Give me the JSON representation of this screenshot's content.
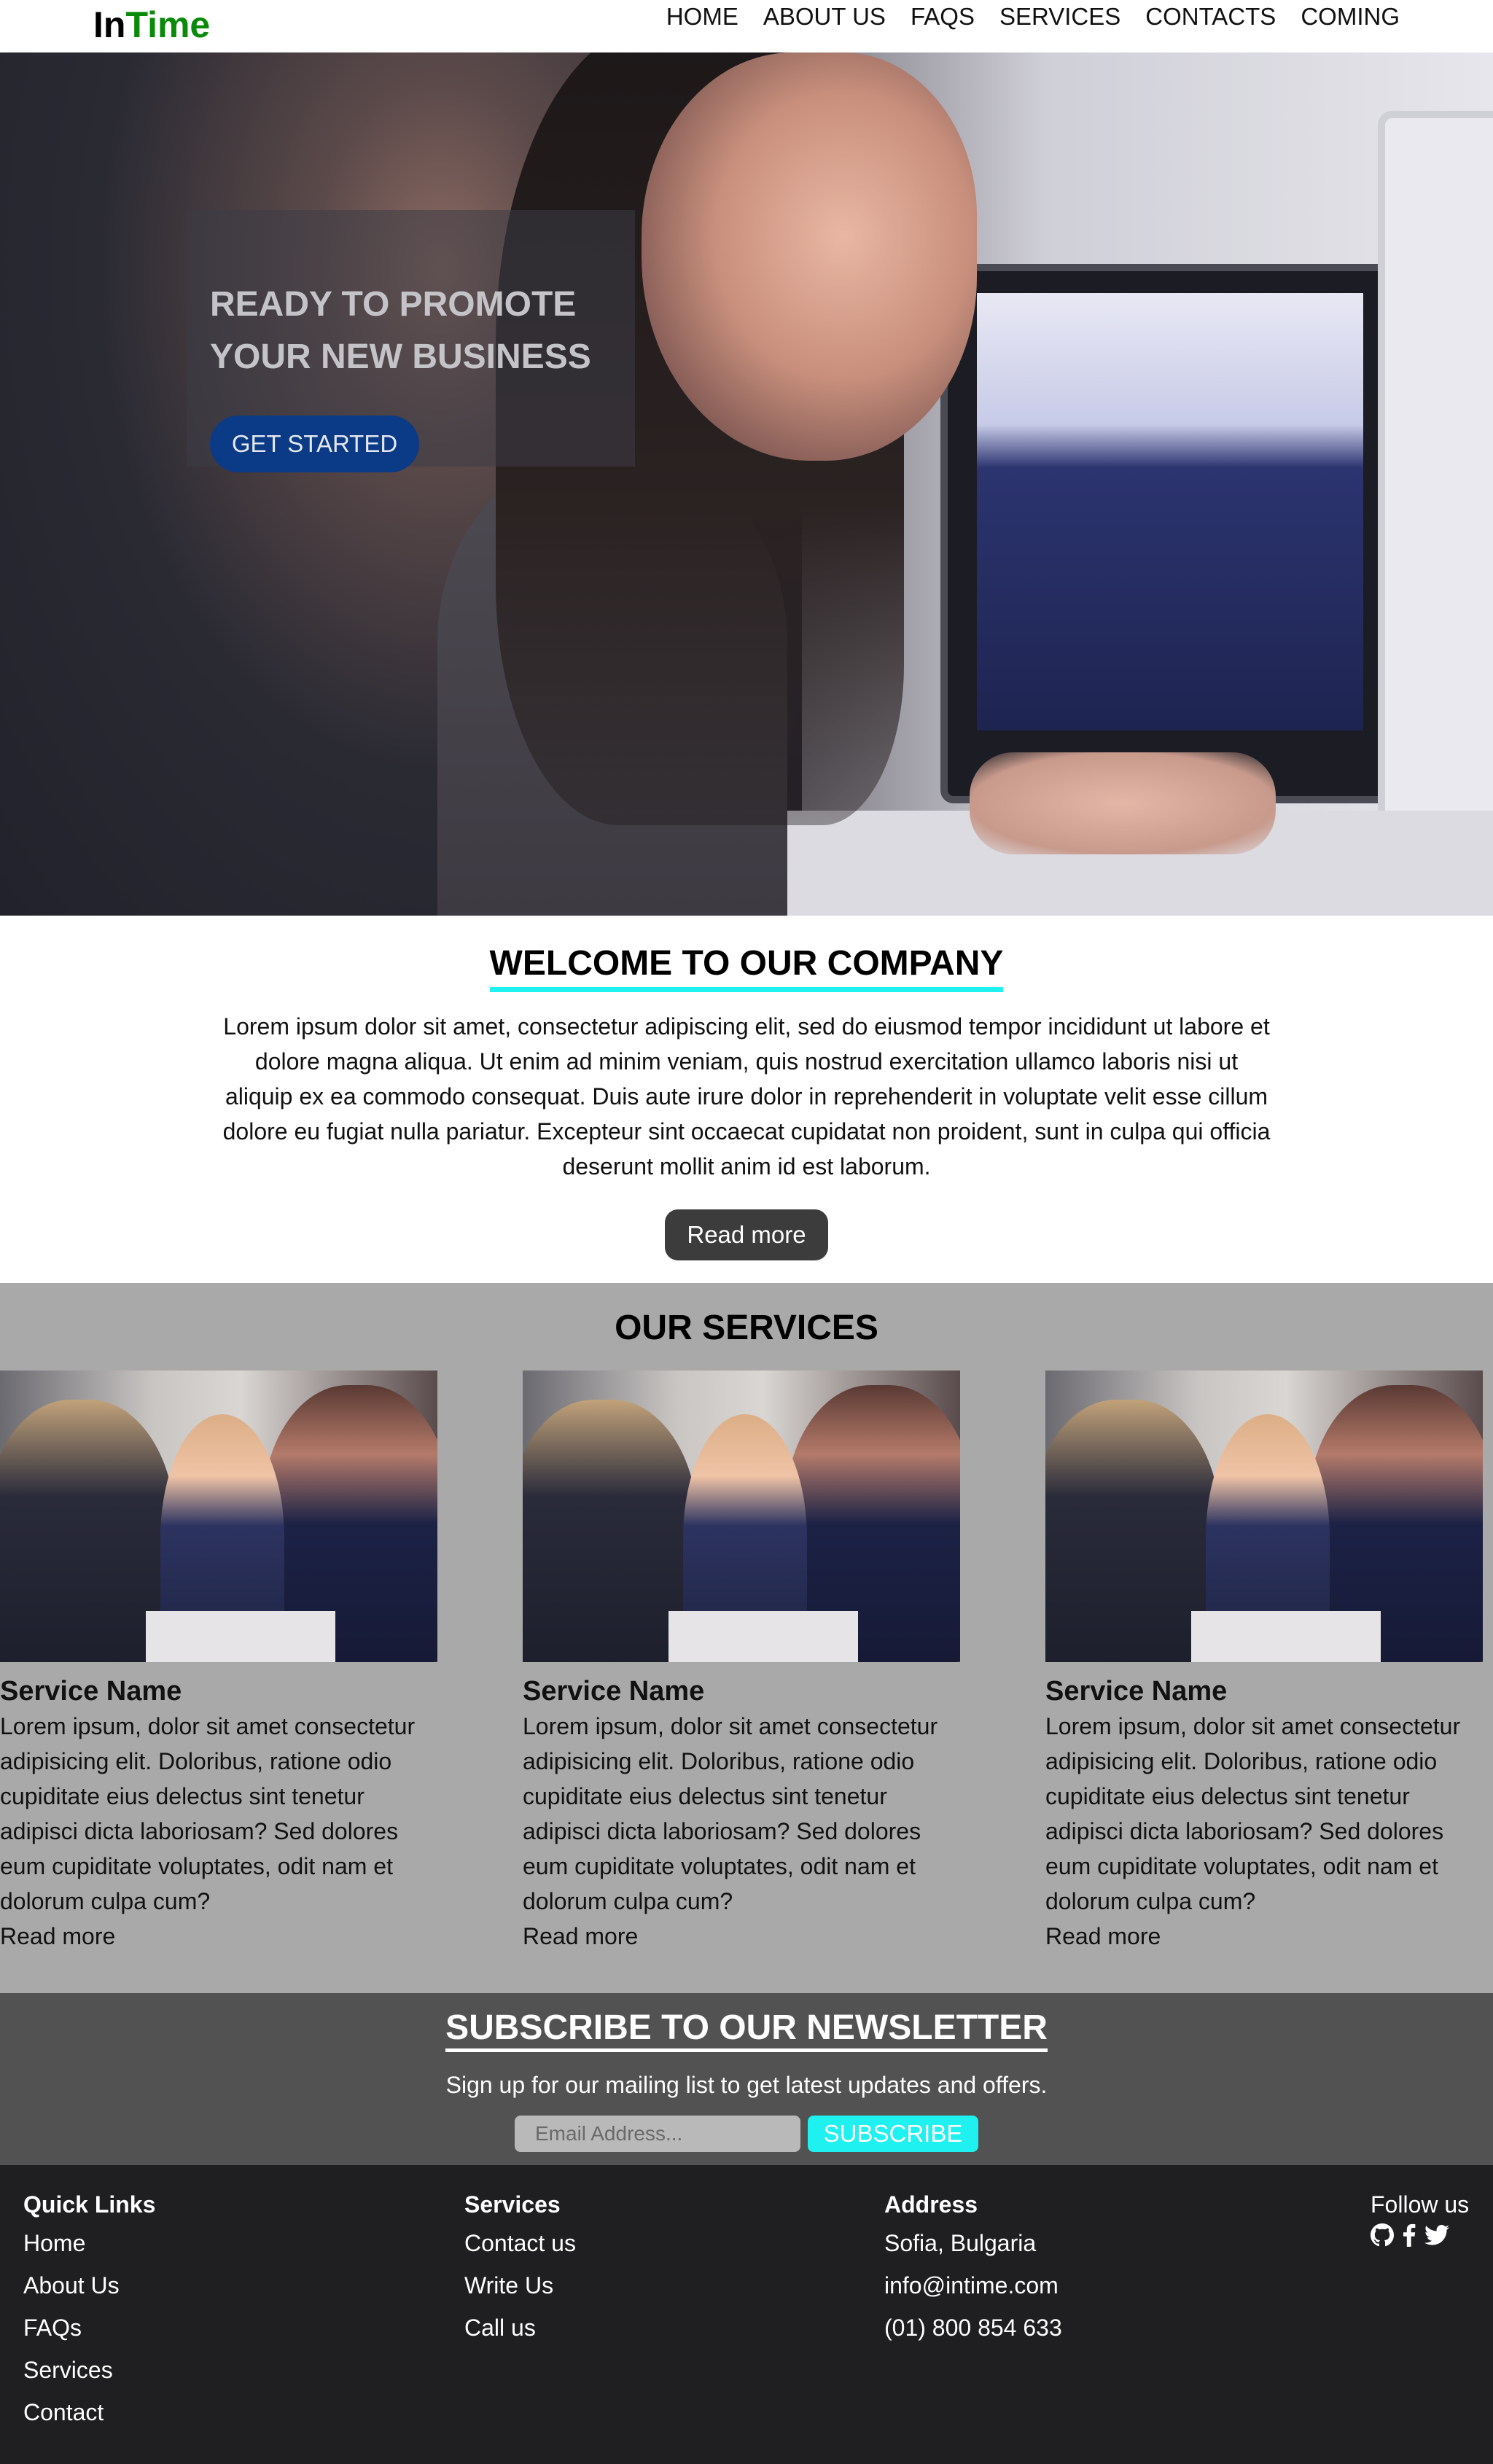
{
  "header": {
    "logo_in": "In",
    "logo_time": "Time",
    "nav": [
      "HOME",
      "ABOUT US",
      "FAQS",
      "SERVICES",
      "CONTACTS",
      "COMING"
    ]
  },
  "hero": {
    "title_line1": "READY TO PROMOTE",
    "title_line2": "YOUR NEW BUSINESS",
    "button": "GET STARTED"
  },
  "welcome": {
    "title": "WELCOME TO OUR COMPANY",
    "text": "Lorem ipsum dolor sit amet, consectetur adipiscing elit, sed do eiusmod tempor incididunt ut labore et dolore magna aliqua. Ut enim ad minim veniam, quis nostrud exercitation ullamco laboris nisi ut aliquip ex ea commodo consequat. Duis aute irure dolor in reprehenderit in voluptate velit esse cillum dolore eu fugiat nulla pariatur. Excepteur sint occaecat cupidatat non proident, sunt in culpa qui officia deserunt mollit anim id est laborum.",
    "button": "Read more"
  },
  "services": {
    "title": "OUR SERVICES",
    "cards": [
      {
        "name": "Service Name",
        "text": "Lorem ipsum, dolor sit amet consectetur adipisicing elit. Doloribus, ratione odio cupiditate eius delectus sint tenetur adipisci dicta laboriosam? Sed dolores eum cupiditate voluptates, odit nam et dolorum culpa cum?",
        "link": "Read more"
      },
      {
        "name": "Service Name",
        "text": "Lorem ipsum, dolor sit amet consectetur adipisicing elit. Doloribus, ratione odio cupiditate eius delectus sint tenetur adipisci dicta laboriosam? Sed dolores eum cupiditate voluptates, odit nam et dolorum culpa cum?",
        "link": "Read more"
      },
      {
        "name": "Service Name",
        "text": "Lorem ipsum, dolor sit amet consectetur adipisicing elit. Doloribus, ratione odio cupiditate eius delectus sint tenetur adipisci dicta laboriosam? Sed dolores eum cupiditate voluptates, odit nam et dolorum culpa cum?",
        "link": "Read more"
      }
    ]
  },
  "newsletter": {
    "title": "SUBSCRIBE TO OUR NEWSLETTER",
    "subtitle": "Sign up for our mailing list to get latest updates and offers.",
    "placeholder": "Email Address...",
    "button": "SUBSCRIBE"
  },
  "footer": {
    "quick_links": {
      "heading": "Quick Links",
      "items": [
        "Home",
        "About Us",
        "FAQs",
        "Services",
        "Contact"
      ]
    },
    "services": {
      "heading": "Services",
      "items": [
        "Contact us",
        "Write Us",
        "Call us"
      ]
    },
    "address": {
      "heading": "Address",
      "items": [
        "Sofia, Bulgaria",
        "info@intime.com",
        "(01) 800 854 633"
      ]
    },
    "follow": "Follow us",
    "social_icons": [
      "github-icon",
      "facebook-icon",
      "twitter-icon"
    ]
  },
  "colors": {
    "logo_green": "#0a8a0a",
    "accent_cyan": "#1ff0f0",
    "hero_button": "#0b3a86",
    "services_bg": "#a9a9a9",
    "newsletter_bg": "#525252",
    "footer_bg": "#1f1e20"
  }
}
